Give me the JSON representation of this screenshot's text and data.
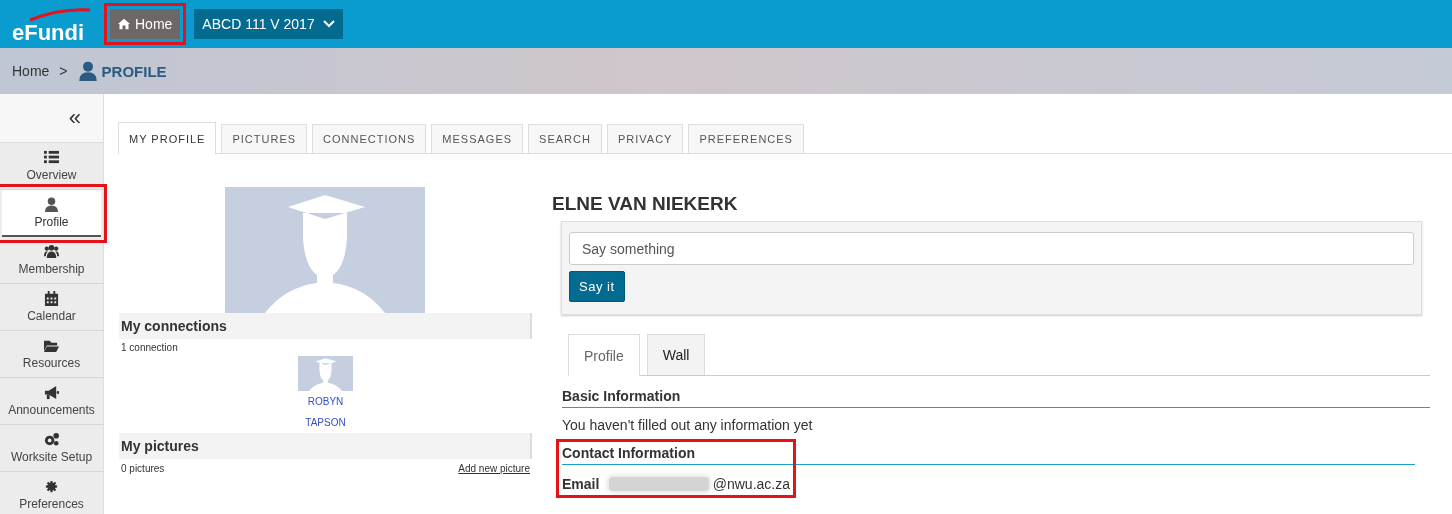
{
  "header": {
    "logo": "eFundi",
    "home_button": {
      "label": "Home",
      "highlighted": true
    },
    "site_menu": {
      "label": "ABCD 111 V 2017"
    }
  },
  "breadcrumb": {
    "home": "Home",
    "separator": ">",
    "current": "PROFILE"
  },
  "sidebar": {
    "collapse_label": "«",
    "items": [
      {
        "label": "Overview",
        "selected": false,
        "highlighted": false
      },
      {
        "label": "Profile",
        "selected": true,
        "highlighted": true
      },
      {
        "label": "Membership",
        "selected": false,
        "highlighted": false
      },
      {
        "label": "Calendar",
        "selected": false,
        "highlighted": false
      },
      {
        "label": "Resources",
        "selected": false,
        "highlighted": false
      },
      {
        "label": "Announcements",
        "selected": false,
        "highlighted": false
      },
      {
        "label": "Worksite Setup",
        "selected": false,
        "highlighted": false
      },
      {
        "label": "Preferences",
        "selected": false,
        "highlighted": false
      }
    ]
  },
  "tabs": [
    {
      "label": "MY PROFILE",
      "selected": true
    },
    {
      "label": "PICTURES",
      "selected": false
    },
    {
      "label": "CONNECTIONS",
      "selected": false
    },
    {
      "label": "MESSAGES",
      "selected": false
    },
    {
      "label": "SEARCH",
      "selected": false
    },
    {
      "label": "PRIVACY",
      "selected": false
    },
    {
      "label": "PREFERENCES",
      "selected": false
    }
  ],
  "left": {
    "connections": {
      "title": "My connections",
      "count": "1 connection",
      "people": [
        {
          "first": "ROBYN",
          "last": "TAPSON"
        }
      ]
    },
    "pictures": {
      "title": "My pictures",
      "count": "0 pictures",
      "add_link": "Add new picture"
    }
  },
  "profile": {
    "name": "ELNE VAN NIEKERK",
    "status": {
      "placeholder": "Say something",
      "button": "Say it"
    },
    "subtabs": [
      {
        "label": "Profile",
        "selected": true
      },
      {
        "label": "Wall",
        "selected": false
      }
    ],
    "sections": [
      {
        "title": "Basic Information",
        "kind": "text",
        "text": "You haven't filled out any information yet",
        "highlighted": false
      },
      {
        "title": "Contact Information",
        "kind": "fields",
        "highlighted": true,
        "fields": [
          {
            "label": "Email",
            "value": "@nwu.ac.za",
            "redacted": true
          }
        ]
      }
    ]
  }
}
